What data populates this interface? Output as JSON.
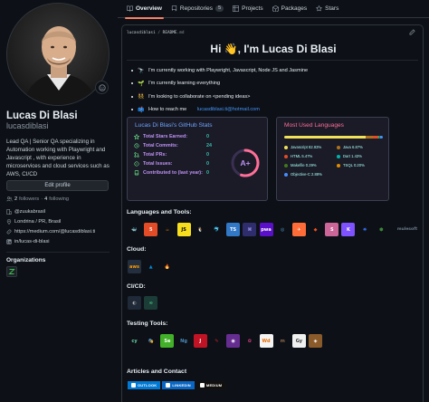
{
  "tabs": [
    {
      "label": "Overview",
      "icon": "book-icon",
      "active": true
    },
    {
      "label": "Repositories",
      "icon": "repo-icon",
      "count": "5"
    },
    {
      "label": "Projects",
      "icon": "table-icon"
    },
    {
      "label": "Packages",
      "icon": "package-icon"
    },
    {
      "label": "Stars",
      "icon": "star-icon"
    }
  ],
  "profile": {
    "name": "Lucas Di Blasi",
    "login": "lucasdiblasi",
    "bio": "Lead QA | Senior QA specializing in Automation working with Playwright and Javascript , with experience in microservices and cloud services such as AWS, CI/CD",
    "edit_label": "Edit profile",
    "followers": "2",
    "followers_label": "followers",
    "following": "4",
    "following_label": "following",
    "company": "@zuukabrasil",
    "location": "Londrina / PR, Brasil",
    "website": "https://medium.com/@lucasdiblasi.ti",
    "linkedin": "in/lucas-di-blasi",
    "orgs_title": "Organizations"
  },
  "readme": {
    "path_user": "lucasdiblasi",
    "path_sep": " / ",
    "path_file": "README",
    "path_ext": ".md",
    "greeting": "Hi 👋, I'm Lucas Di Blasi",
    "bullets": [
      {
        "emoji": "🔭",
        "text": "I'm currently working with Playwright, Javascript, Node JS and Jasmine"
      },
      {
        "emoji": "🌱",
        "text": "I'm currently learning everything"
      },
      {
        "emoji": "👯",
        "text": "I'm looking to collaborate on <pending ideas>"
      },
      {
        "emoji": "📫",
        "text": "How to reach me ",
        "link": "lucasdiblasi.ti@hotmail.com"
      }
    ]
  },
  "stats": {
    "title": "Lucas Di Blasi's GitHub Stats",
    "rows": [
      {
        "label": "Total Stars Earned:",
        "value": "0",
        "icon": "star-icon"
      },
      {
        "label": "Total Commits:",
        "value": "24",
        "icon": "clock-icon"
      },
      {
        "label": "Total PRs:",
        "value": "0",
        "icon": "pull-request-icon"
      },
      {
        "label": "Total Issues:",
        "value": "0",
        "icon": "issue-icon"
      },
      {
        "label": "Contributed to (last year):",
        "value": "0",
        "icon": "repo-icon"
      }
    ],
    "grade": "A+",
    "grade_progress": 0.55
  },
  "languages": {
    "title": "Most Used Languages",
    "items": [
      {
        "name": "Javascript 82.93%",
        "percent": 82.93,
        "color": "#f1e05a"
      },
      {
        "name": "Java 6.87%",
        "percent": 6.87,
        "color": "#b07219"
      },
      {
        "name": "HTML 5.47%",
        "percent": 5.47,
        "color": "#e34c26"
      },
      {
        "name": "Dart 1.43%",
        "percent": 1.43,
        "color": "#00b4ab"
      },
      {
        "name": "Makefile 0.29%",
        "percent": 0.29,
        "color": "#427819"
      },
      {
        "name": "TSQL 0.20%",
        "percent": 0.2,
        "color": "#e38c00"
      },
      {
        "name": "Objective-C 2.88%",
        "percent": 2.88,
        "color": "#438eff"
      }
    ]
  },
  "sections": {
    "languages_tools": "Languages and Tools:",
    "cloud": "Cloud:",
    "cicd": "CI/CD:",
    "testing": "Testing Tools:",
    "articles": "Articles and Contact"
  },
  "tool_icons": [
    {
      "name": "docker-icon",
      "text": "🐳",
      "bg": "#0d1117",
      "fg": "#2496ed"
    },
    {
      "name": "html5-icon",
      "text": "5",
      "bg": "#e34c26",
      "fg": "#fff"
    },
    {
      "name": "java-icon",
      "text": "☕",
      "bg": "#0d1117",
      "fg": "#e76f00"
    },
    {
      "name": "javascript-icon",
      "text": "JS",
      "bg": "#f7df1e",
      "fg": "#000"
    },
    {
      "name": "linux-icon",
      "text": "🐧",
      "bg": "#0d1117",
      "fg": "#fff"
    },
    {
      "name": "mysql-icon",
      "text": "🐬",
      "bg": "#0d1117",
      "fg": "#00758f"
    },
    {
      "name": "typescript-icon",
      "text": "TS",
      "bg": "#3178c6",
      "fg": "#fff"
    },
    {
      "name": "postman-like-icon",
      "text": "⌘",
      "bg": "#2f2d6b",
      "fg": "#a8a4ff"
    },
    {
      "name": "pwa-icon",
      "text": "pwa",
      "bg": "#5a0fc8",
      "fg": "#fff"
    },
    {
      "name": "matplotlib-like-icon",
      "text": "◎",
      "bg": "#0d1117",
      "fg": "#4a9ed8"
    },
    {
      "name": "postman-icon",
      "text": "✈",
      "bg": "#ff6c37",
      "fg": "#fff"
    },
    {
      "name": "figma-icon",
      "text": "◆",
      "bg": "#0d1117",
      "fg": "#f24e1e"
    },
    {
      "name": "sass-icon",
      "text": "S",
      "bg": "#cc6699",
      "fg": "#fff"
    },
    {
      "name": "kotlin-icon",
      "text": "K",
      "bg": "#7f52ff",
      "fg": "#fff"
    },
    {
      "name": "kubernetes-icon",
      "text": "⎈",
      "bg": "#0d1117",
      "fg": "#326ce5"
    },
    {
      "name": "nodejs-icon",
      "text": "⬢",
      "bg": "#0d1117",
      "fg": "#3c873a"
    },
    {
      "name": "mulesoft-icon",
      "text": "mulesoft",
      "bg": "transparent",
      "fg": "#6b7c8c",
      "wide": true
    }
  ],
  "cloud_icons": [
    {
      "name": "aws-icon",
      "text": "aws",
      "bg": "#232f3e",
      "fg": "#ff9900"
    },
    {
      "name": "azure-icon",
      "text": "▲",
      "bg": "#0d1117",
      "fg": "#0089d6"
    },
    {
      "name": "firebase-icon",
      "text": "🔥",
      "bg": "#0d1117",
      "fg": "#ffca28"
    }
  ],
  "cicd_icons": [
    {
      "name": "bitbucket-icon",
      "text": "◐",
      "bg": "#1f2937",
      "fg": "#aaa"
    },
    {
      "name": "gitlab-ci-icon",
      "text": "∞",
      "bg": "#1c3c38",
      "fg": "#4ade80"
    }
  ],
  "testing_icons": [
    {
      "name": "cypress-icon",
      "text": "cy",
      "bg": "#0d1117",
      "fg": "#69d3a7"
    },
    {
      "name": "cucumber-icon",
      "text": "🎭",
      "bg": "#0d1117",
      "fg": "#2ead33"
    },
    {
      "name": "selenium-icon",
      "text": "Se",
      "bg": "#43b02a",
      "fg": "#fff"
    },
    {
      "name": "testng-icon",
      "text": "Ng",
      "bg": "#0d1117",
      "fg": "#4b8bbe"
    },
    {
      "name": "jest-icon",
      "text": "J",
      "bg": "#c21325",
      "fg": "#fff"
    },
    {
      "name": "jmeter-icon",
      "text": "✎",
      "bg": "#0d1117",
      "fg": "#d22128"
    },
    {
      "name": "appium-icon",
      "text": "◉",
      "bg": "#662d91",
      "fg": "#fff"
    },
    {
      "name": "karate-icon",
      "text": "✿",
      "bg": "#0d1117",
      "fg": "#e83e8c"
    },
    {
      "name": "webdriverio-icon",
      "text": "Wd",
      "bg": "#f4f4f4",
      "fg": "#e96c00"
    },
    {
      "name": "mocha-icon",
      "text": "m",
      "bg": "#0d1117",
      "fg": "#8d6748"
    },
    {
      "name": "galen-icon",
      "text": "Gy",
      "bg": "#f0f0f0",
      "fg": "#333"
    },
    {
      "name": "postman-flow-icon",
      "text": "◈",
      "bg": "#8b5a2b",
      "fg": "#fff"
    }
  ],
  "shields": [
    {
      "label": "OUTLOOK",
      "bg": "#0078d4",
      "icon": "outlook-icon"
    },
    {
      "label": "LINKEDIN",
      "bg": "#0a66c2",
      "icon": "linkedin-icon"
    },
    {
      "label": "MEDIUM",
      "bg": "#12100e",
      "icon": "medium-icon"
    }
  ]
}
